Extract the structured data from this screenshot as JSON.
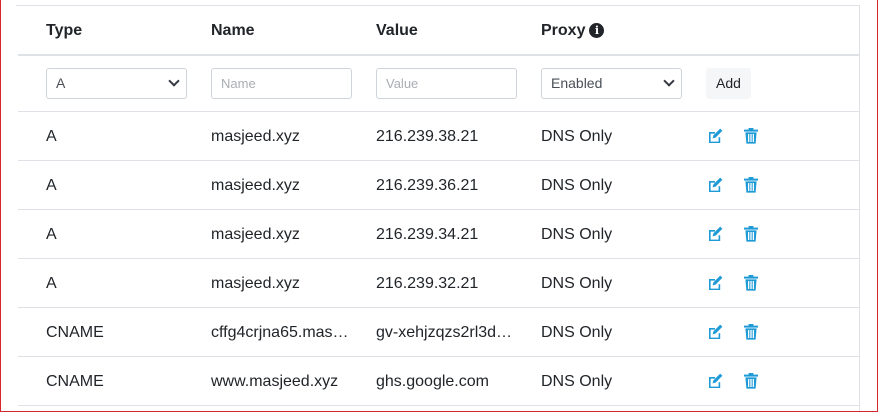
{
  "colors": {
    "accent": "#1e9bd7",
    "frame_border": "#d9262c"
  },
  "table": {
    "headers": {
      "type": "Type",
      "name": "Name",
      "value": "Value",
      "proxy": "Proxy"
    },
    "proxy_info_icon": "info-circle-icon",
    "form": {
      "type_selected": "A",
      "name_placeholder": "Name",
      "value_placeholder": "Value",
      "proxy_selected": "Enabled",
      "add_label": "Add"
    },
    "rows": [
      {
        "type": "A",
        "name": "masjeed.xyz",
        "value": "216.239.38.21",
        "proxy": "DNS Only"
      },
      {
        "type": "A",
        "name": "masjeed.xyz",
        "value": "216.239.36.21",
        "proxy": "DNS Only"
      },
      {
        "type": "A",
        "name": "masjeed.xyz",
        "value": "216.239.34.21",
        "proxy": "DNS Only"
      },
      {
        "type": "A",
        "name": "masjeed.xyz",
        "value": "216.239.32.21",
        "proxy": "DNS Only"
      },
      {
        "type": "CNAME",
        "name": "cffg4crjna65.mas…",
        "value": "gv-xehjzqzs2rl3d…",
        "proxy": "DNS Only"
      },
      {
        "type": "CNAME",
        "name": "www.masjeed.xyz",
        "value": "ghs.google.com",
        "proxy": "DNS Only"
      }
    ],
    "row_actions": [
      "edit-icon",
      "trash-icon"
    ]
  }
}
